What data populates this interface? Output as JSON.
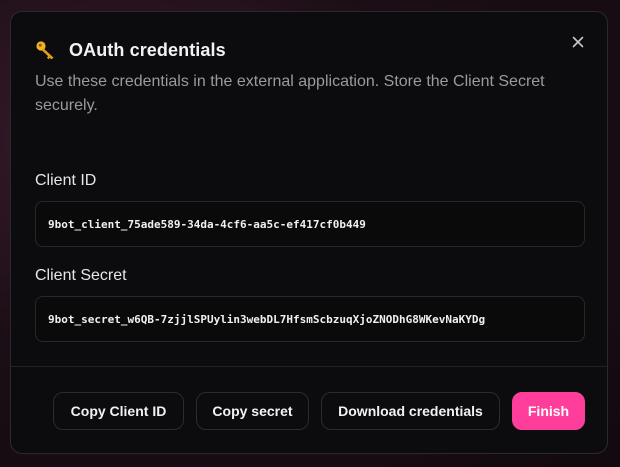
{
  "dialog": {
    "title": "OAuth credentials",
    "title_icon": "key-icon",
    "description": "Use these credentials in the external application. Store the Client Secret securely.",
    "close_icon": "close-icon"
  },
  "fields": {
    "client_id": {
      "label": "Client ID",
      "value": "9bot_client_75ade589-34da-4cf6-aa5c-ef417cf0b449"
    },
    "client_secret": {
      "label": "Client Secret",
      "value": "9bot_secret_w6QB-7zjjlSPUylin3webDL7HfsmScbzuqXjoZNODhG8WKevNaKYDg"
    }
  },
  "actions": {
    "copy_id": "Copy Client ID",
    "copy_secret": "Copy secret",
    "download": "Download credentials",
    "finish": "Finish"
  },
  "colors": {
    "accent": "#ff3d9a",
    "background": "#0c0c0e",
    "key_icon": "#f0b323"
  }
}
